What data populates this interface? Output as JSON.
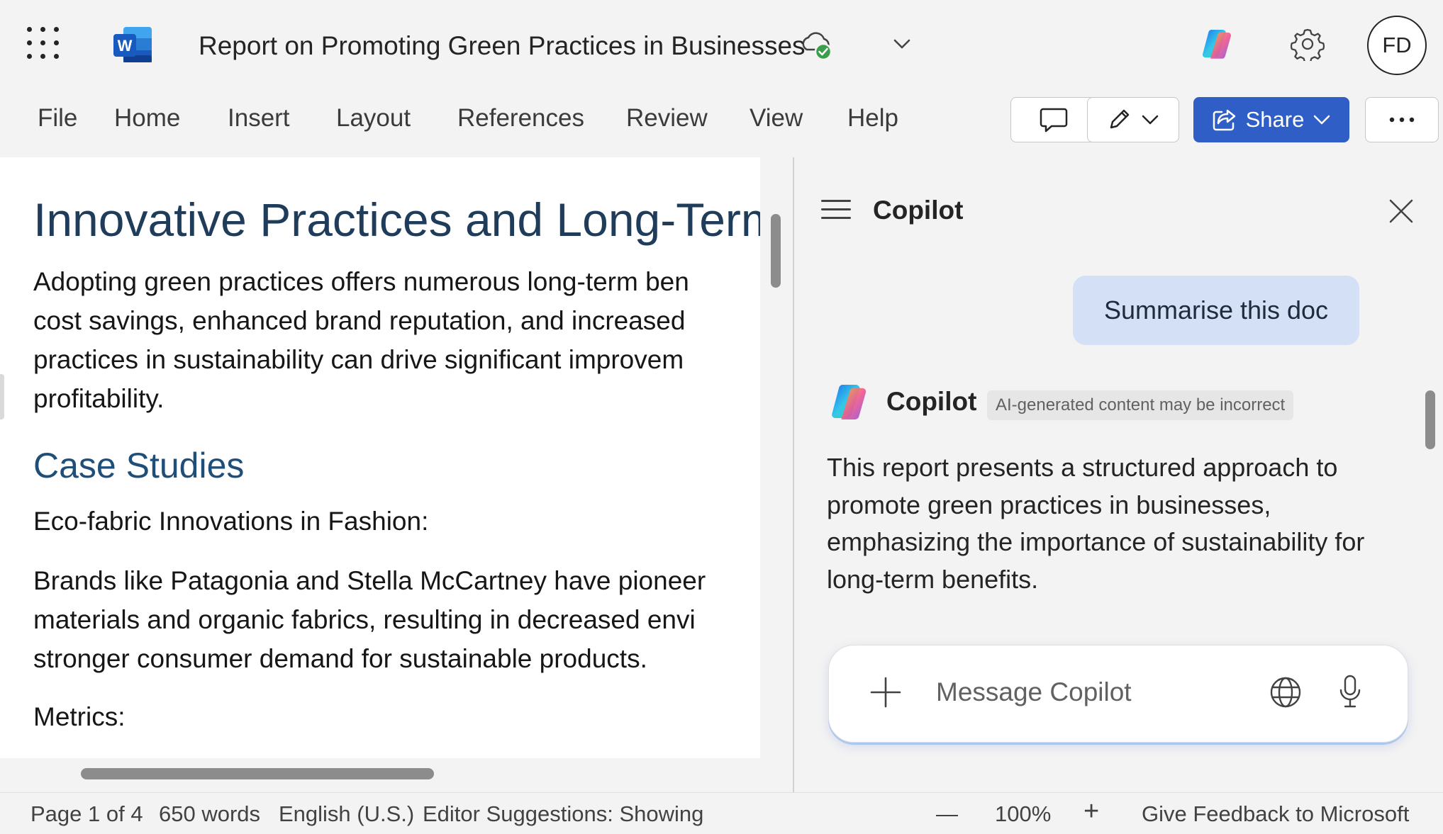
{
  "title_bar": {
    "document_title": "Report on Promoting Green Practices in Businesses",
    "avatar_initials": "FD",
    "save_status_icon": "cloud-saved-check-icon"
  },
  "ribbon": {
    "tabs": [
      "File",
      "Home",
      "Insert",
      "Layout",
      "References",
      "Review",
      "View",
      "Help"
    ],
    "share_label": "Share"
  },
  "document": {
    "heading": "Innovative Practices and Long-Term",
    "intro_lines": [
      "Adopting green practices offers numerous long-term ben",
      "cost savings, enhanced brand reputation, and increased",
      "practices in sustainability can drive significant improvem",
      "profitability."
    ],
    "subheading": "Case Studies",
    "case_title": "Eco-fabric Innovations in Fashion:",
    "case_lines": [
      "Brands like Patagonia and Stella McCartney have pioneer",
      "materials and organic fabrics, resulting in decreased envi",
      "stronger consumer demand for sustainable products."
    ],
    "metrics_label": "Metrics:"
  },
  "copilot": {
    "pane_title": "Copilot",
    "user_message": "Summarise this doc",
    "assistant_name": "Copilot",
    "ai_disclaimer": "AI-generated content may be incorrect",
    "response_lines": [
      "This report presents a structured approach to",
      "promote green practices in businesses,",
      "emphasizing the importance of sustainability for",
      "long-term benefits."
    ],
    "input_placeholder": "Message Copilot"
  },
  "status_bar": {
    "page": "Page 1 of 4",
    "words": "650 words",
    "language": "English (U.S.)",
    "editor": "Editor Suggestions: Showing",
    "zoom_out": "—",
    "zoom": "100%",
    "zoom_in": "+",
    "feedback": "Give Feedback to Microsoft"
  },
  "colors": {
    "accent_blue": "#2f5fc6",
    "heading": "#1f3d5b",
    "user_bubble": "#d4e0f5",
    "background": "#f3f3f3"
  }
}
